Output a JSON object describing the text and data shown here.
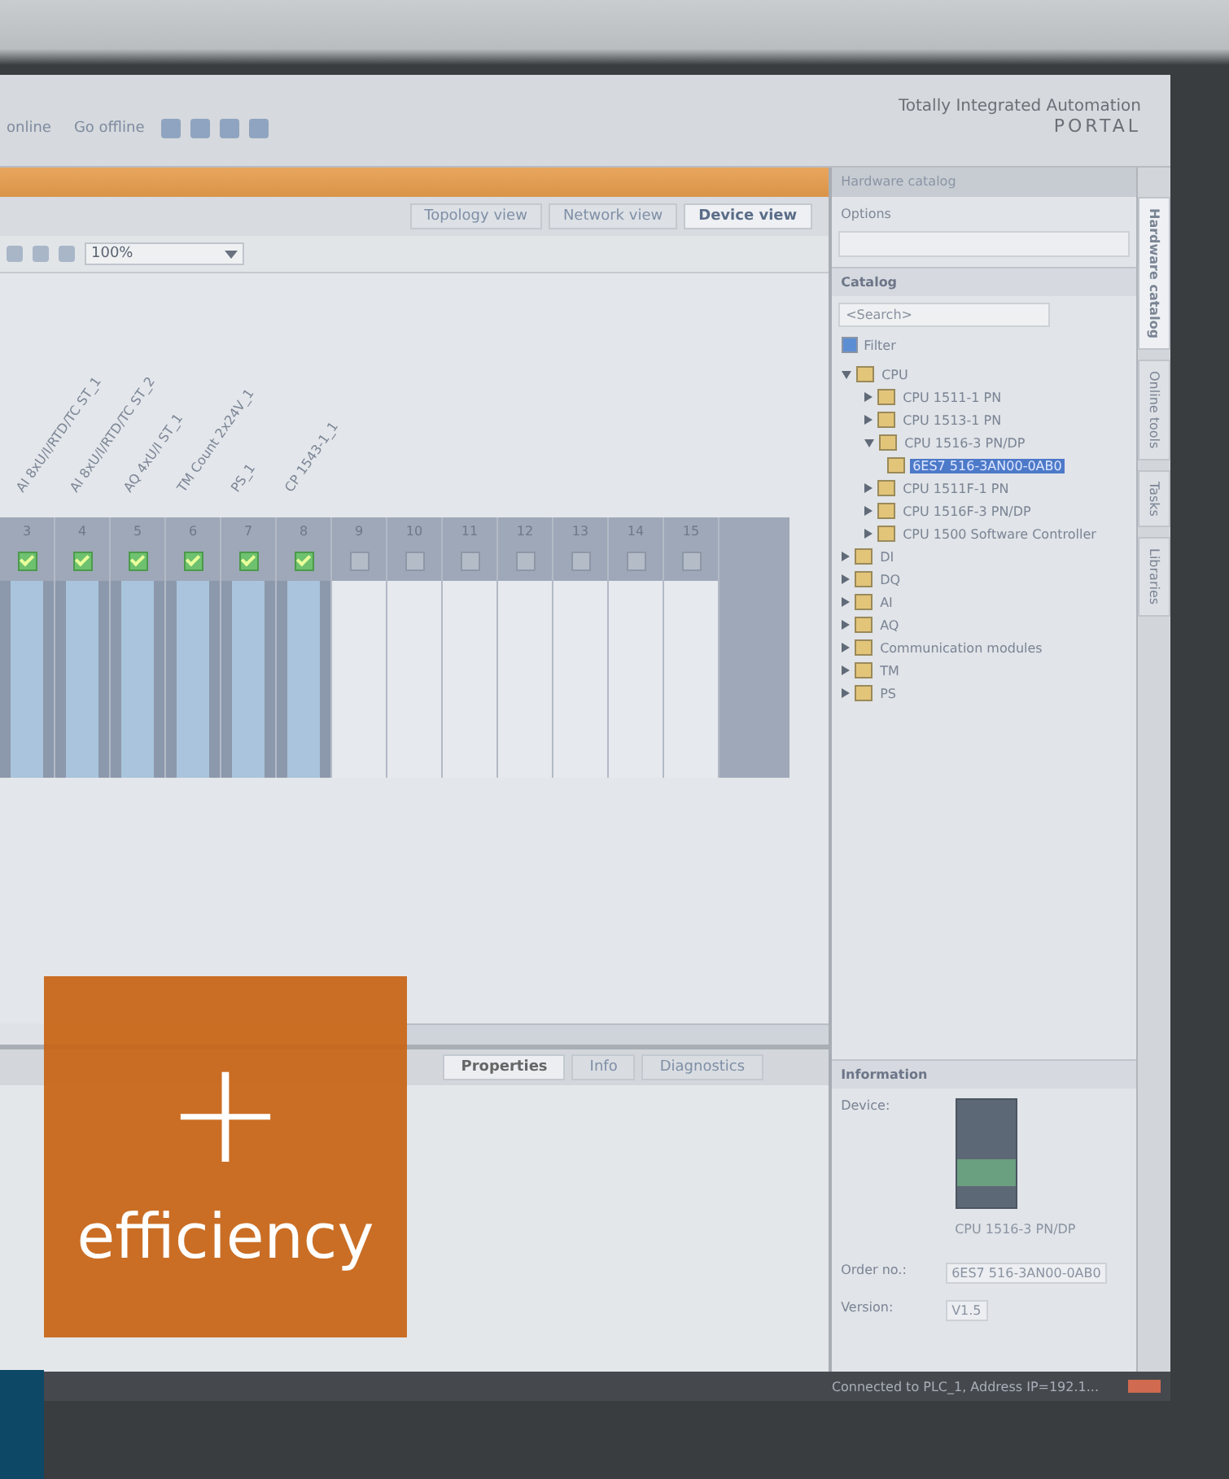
{
  "toolbar": {
    "buttons": [
      "online",
      "Go offline"
    ],
    "logo_line_1": "Totally Integrated Automation",
    "logo_line_2": "PORTAL"
  },
  "views": [
    {
      "label": "Topology view",
      "selected": false
    },
    {
      "label": "Network view",
      "selected": false
    },
    {
      "label": "Device view",
      "selected": true
    }
  ],
  "zoom": "100%",
  "module_labels": [
    "AI 8xU/I/RTD/TC ST_1",
    "AI 8xU/I/RTD/TC ST_2",
    "AQ 4xU/I ST_1",
    "TM Count 2x24V_1",
    "PS_1",
    "CP 1543-1_1"
  ],
  "slots": [
    {
      "number": "3",
      "configured": true
    },
    {
      "number": "4",
      "configured": true
    },
    {
      "number": "5",
      "configured": true
    },
    {
      "number": "6",
      "configured": true
    },
    {
      "number": "7",
      "configured": true
    },
    {
      "number": "8",
      "configured": true
    },
    {
      "number": "9",
      "configured": false
    },
    {
      "number": "10",
      "configured": false
    },
    {
      "number": "11",
      "configured": false
    },
    {
      "number": "12",
      "configured": false
    },
    {
      "number": "13",
      "configured": false
    },
    {
      "number": "14",
      "configured": false
    },
    {
      "number": "15",
      "configured": false
    }
  ],
  "catalog": {
    "title": "Hardware catalog",
    "options": "Options",
    "section": "Catalog",
    "search_placeholder": "<Search>",
    "filter": {
      "label": "Filter",
      "checked": true
    },
    "tree": [
      {
        "label": "CPU",
        "expanded": true,
        "selected": false,
        "children": [
          {
            "label": "CPU 1511-1 PN",
            "expanded": false,
            "selected": false
          },
          {
            "label": "CPU 1513-1 PN",
            "expanded": false,
            "selected": false
          },
          {
            "label": "CPU 1516-3 PN/DP",
            "expanded": true,
            "selected": false,
            "children": [
              {
                "label": "6ES7 516-3AN00-0AB0",
                "selected": true
              }
            ]
          },
          {
            "label": "CPU 1511F-1 PN",
            "expanded": false,
            "selected": false
          },
          {
            "label": "CPU 1516F-3 PN/DP",
            "expanded": false,
            "selected": false
          },
          {
            "label": "CPU 1500 Software Controller",
            "expanded": false,
            "selected": false
          }
        ]
      },
      {
        "label": "DI",
        "expanded": false,
        "selected": false
      },
      {
        "label": "DQ",
        "expanded": false,
        "selected": false
      },
      {
        "label": "AI",
        "expanded": false,
        "selected": false
      },
      {
        "label": "AQ",
        "expanded": false,
        "selected": false
      },
      {
        "label": "Communication modules",
        "expanded": false,
        "selected": false
      },
      {
        "label": "TM",
        "expanded": false,
        "selected": false
      },
      {
        "label": "PS",
        "expanded": false,
        "selected": false
      }
    ]
  },
  "side_tabs": [
    {
      "label": "Hardware catalog",
      "selected": true
    },
    {
      "label": "Online tools",
      "selected": false
    },
    {
      "label": "Tasks",
      "selected": false
    },
    {
      "label": "Libraries",
      "selected": false
    }
  ],
  "inspector": {
    "tabs": [
      {
        "label": "Properties",
        "selected": true
      },
      {
        "label": "Info",
        "selected": false
      },
      {
        "label": "Diagnostics",
        "selected": false
      }
    ]
  },
  "information": {
    "title": "Information",
    "device_label": "Device:",
    "device_name": "CPU 1516-3 PN/DP",
    "fields": [
      {
        "label": "Order no.:",
        "value": "6ES7 516-3AN00-0AB0"
      },
      {
        "label": "Version:",
        "value": "V1.5"
      }
    ]
  },
  "status": "Connected to PLC_1, Address IP=192.1...",
  "badge": {
    "symbol": "+",
    "text": "efficiency"
  }
}
